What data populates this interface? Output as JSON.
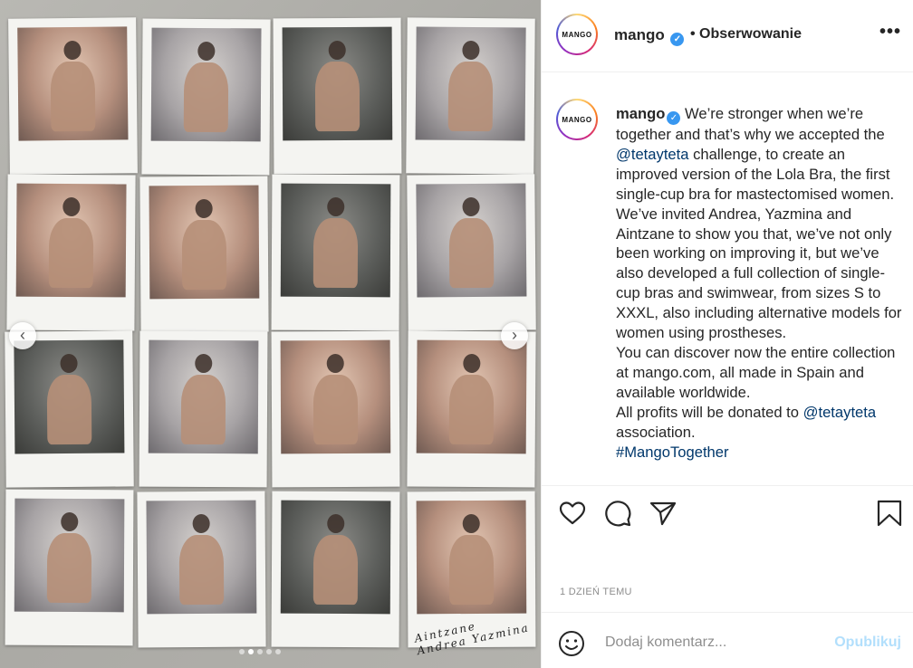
{
  "post": {
    "carousel": {
      "signature_text": "Aintzane  Andrea  Yazmina",
      "prev_glyph": "‹",
      "next_glyph": "›",
      "dots": 5,
      "active_dot": 2
    }
  },
  "header": {
    "avatar_text": "MANGO",
    "username": "mango",
    "verified_glyph": "✓",
    "follow_label": "• Obserwowanie",
    "more_glyph": "•••"
  },
  "caption": {
    "avatar_text": "MANGO",
    "username": "mango",
    "verified_glyph": "✓",
    "text_1": "We’re stronger when we’re together and that’s why we accepted the ",
    "mention_1": "@tetayteta",
    "text_2": " challenge, to create an improved version of the Lola Bra, the first single-cup bra for mastectomised women. We’ve invited Andrea, Yazmina and Aintzane to show you that, we’ve not only been working on improving it, but we’ve also developed a full collection of single-cup bras and swimwear, from sizes S to XXXL, also including alternative models for women using prostheses.",
    "text_3": "You can discover now the entire collection at mango.com, all made in Spain and available worldwide.",
    "text_4": "All profits will be donated to ",
    "mention_2": "@tetayteta",
    "text_5": " association.",
    "hashtag": "#MangoTogether"
  },
  "actions": {
    "like_icon": "heart-icon",
    "comment_icon": "comment-icon",
    "share_icon": "paper-plane-icon",
    "save_icon": "bookmark-icon"
  },
  "timestamp": "1 DZIEŃ TEMU",
  "comment_bar": {
    "emoji_icon": "smiley-icon",
    "placeholder": "Dodaj komentarz...",
    "publish_label": "Opublikuj"
  },
  "colors": {
    "link": "#00376b",
    "verified": "#3897f0",
    "publish_disabled": "#b2dffc",
    "muted": "#8e8e8e"
  }
}
